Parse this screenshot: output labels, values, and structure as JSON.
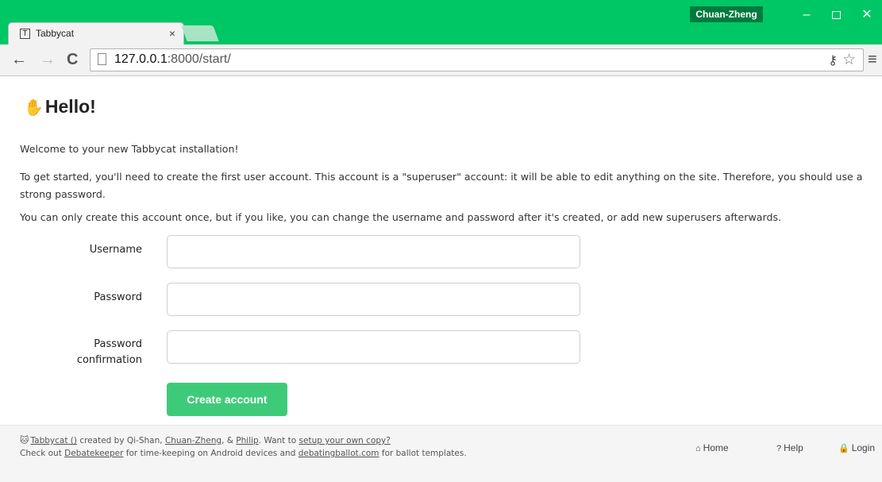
{
  "browser": {
    "tab_title": "Tabbycat",
    "tab_favicon": "T",
    "profile_name": "Chuan-Zheng",
    "url_host": "127.0.0.1",
    "url_path": ":8000/start/"
  },
  "page": {
    "heading": "Hello!",
    "intro": "Welcome to your new Tabbycat installation!",
    "paragraph_1": "To get started, you'll need to create the first user account. This account is a \"superuser\" account: it will be able to edit anything on the site. Therefore, you should use a strong password.",
    "paragraph_2": "You can only create this account once, but if you like, you can change the username and password after it's created, or add new superusers afterwards."
  },
  "form": {
    "username_label": "Username",
    "username_value": "",
    "password_label": "Password",
    "password_value": "",
    "confirm_label_1": "Password",
    "confirm_label_2": "confirmation",
    "confirm_value": "",
    "submit_label": "Create account"
  },
  "footer": {
    "tabbycat_link": "Tabbycat ()",
    "created_by": " created by Qi-Shan, ",
    "author_2": "Chuan-Zheng",
    "sep": ", & ",
    "author_3": "Philip",
    "want": ". Want to ",
    "setup_link": "setup your own copy?",
    "check_out": "Check out ",
    "debatekeeper_link": "Debatekeeper",
    "timekeeping": " for time-keeping on Android devices and ",
    "ballot_link": "debatingballot.com",
    "templates": " for ballot templates.",
    "nav_home": "Home",
    "nav_help": "Help",
    "nav_login": "Login"
  },
  "icons": {
    "hand": "wave-hand-icon",
    "cat": "cat-icon",
    "home": "home-icon",
    "help": "help-icon",
    "lock": "lock-icon"
  },
  "colors": {
    "accent": "#00c765",
    "button": "#3ecb79",
    "profile": "#007a3e"
  }
}
